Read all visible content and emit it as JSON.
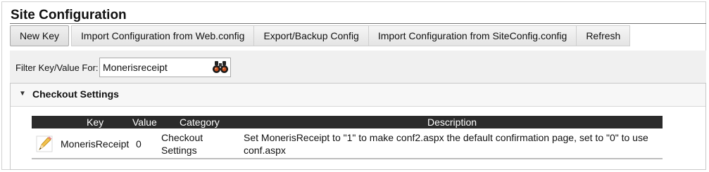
{
  "page": {
    "title": "Site Configuration"
  },
  "toolbar": {
    "buttons": [
      {
        "label": "New Key"
      },
      {
        "label": "Import Configuration from Web.config"
      },
      {
        "label": "Export/Backup Config"
      },
      {
        "label": "Import Configuration from SiteConfig.config"
      },
      {
        "label": "Refresh"
      }
    ]
  },
  "filter": {
    "label": "Filter Key/Value For:",
    "value": "Monerisreceipt",
    "search_icon": "binoculars-icon"
  },
  "section": {
    "title": "Checkout Settings",
    "expanded": true
  },
  "table": {
    "columns": [
      "Key",
      "Value",
      "Category",
      "Description"
    ],
    "rows": [
      {
        "key": "MonerisReceipt",
        "value": "0",
        "category_line1": "Checkout",
        "category_line2": "Settings",
        "description_line1": "Set MonerisReceipt to \"1\" to make conf2.aspx the default confirmation page, set to \"0\" to use",
        "description_line2": "conf.aspx",
        "edit_icon": "pencil-icon"
      }
    ]
  },
  "colors": {
    "header_bg": "#2b2b2b",
    "filter_bg": "#f0f0f0"
  }
}
